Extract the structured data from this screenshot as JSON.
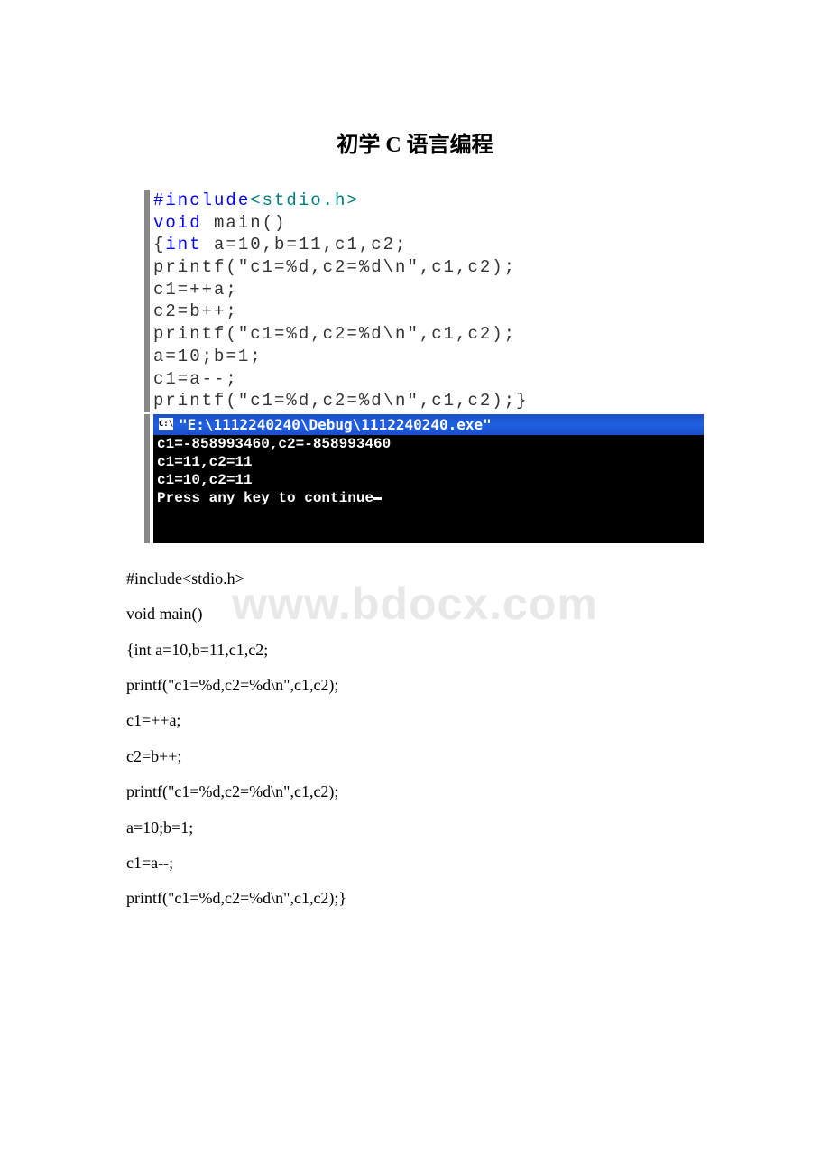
{
  "title": "初学 C 语言编程",
  "code_block": {
    "line1a": "#include",
    "line1b": "<stdio.h>",
    "line2a": "void",
    "line2b": " main()",
    "line3a": "{",
    "line3b": "int",
    "line3c": " a=10,b=11,c1,c2;",
    "line4": "printf(\"c1=%d,c2=%d\\n\",c1,c2);",
    "line5": "c1=++a;",
    "line6": "c2=b++;",
    "line7": "printf(\"c1=%d,c2=%d\\n\",c1,c2);",
    "line8": "a=10;b=1;",
    "line9": "c1=a--;",
    "line10": "printf(\"c1=%d,c2=%d\\n\",c1,c2);}"
  },
  "terminal": {
    "icon_text": "C:\\",
    "title": "\"E:\\1112240240\\Debug\\1112240240.exe\"",
    "line1": "c1=-858993460,c2=-858993460",
    "line2": "c1=11,c2=11",
    "line3": "c1=10,c2=11",
    "line4": "Press any key to continue"
  },
  "watermark": "www.bdocx.com",
  "text_lines": [
    "#include<stdio.h>",
    "void main()",
    "{int a=10,b=11,c1,c2;",
    "printf(\"c1=%d,c2=%d\\n\",c1,c2);",
    "c1=++a;",
    "c2=b++;",
    "printf(\"c1=%d,c2=%d\\n\",c1,c2);",
    "a=10;b=1;",
    "c1=a--;",
    "printf(\"c1=%d,c2=%d\\n\",c1,c2);}"
  ]
}
